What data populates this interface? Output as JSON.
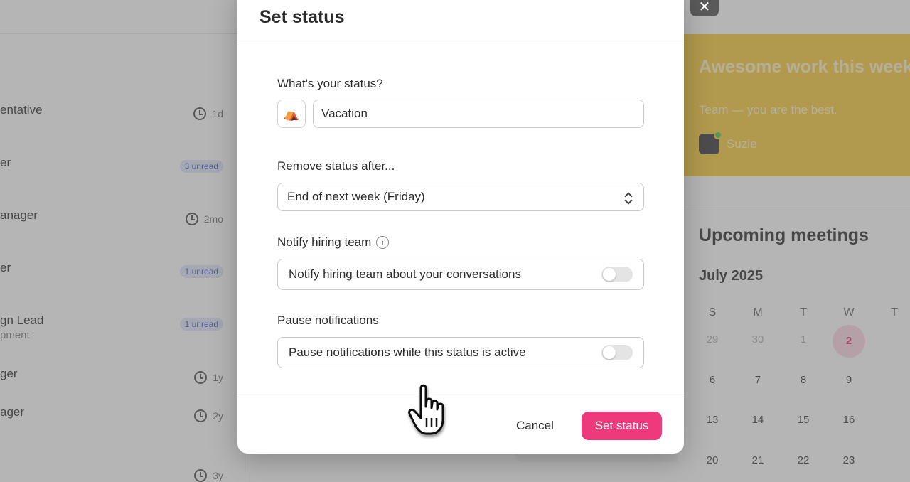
{
  "conversations": [
    {
      "title": "entative",
      "sub": "",
      "meta_type": "time",
      "meta": "1d"
    },
    {
      "title": "er",
      "sub": "",
      "meta_type": "badge",
      "meta": "3 unread"
    },
    {
      "title": "anager",
      "sub": "",
      "meta_type": "time",
      "meta": "2mo"
    },
    {
      "title": "er",
      "sub": "",
      "meta_type": "badge",
      "meta": "1 unread"
    },
    {
      "title": "gn Lead",
      "sub": "pment",
      "meta_type": "badge",
      "meta": "1 unread"
    },
    {
      "title": "ger",
      "sub": "",
      "meta_type": "time",
      "meta": "1y"
    },
    {
      "title": "ager",
      "sub": "",
      "meta_type": "time",
      "meta": "2y"
    },
    {
      "title": "",
      "sub": "",
      "meta_type": "time",
      "meta": "3y"
    }
  ],
  "kudos": {
    "title": "Awesome work this week",
    "text": "Team — you are the best.",
    "user": "Suzie"
  },
  "meetings": {
    "title": "Upcoming meetings",
    "month": "July 2025",
    "weekdays": [
      "S",
      "M",
      "T",
      "W",
      "T"
    ],
    "weeks": [
      [
        "29",
        "30",
        "1",
        "2",
        ""
      ],
      [
        "6",
        "7",
        "8",
        "9",
        ""
      ],
      [
        "13",
        "14",
        "15",
        "16",
        ""
      ],
      [
        "20",
        "21",
        "22",
        "23",
        ""
      ]
    ],
    "today": "2"
  },
  "modal": {
    "close_icon": "close-icon",
    "title": "Set status",
    "status_label": "What's your status?",
    "status_emoji": "⛺",
    "status_value": "Vacation",
    "remove_label": "Remove status after...",
    "remove_value": "End of next week (Friday)",
    "notify_label": "Notify hiring team",
    "notify_toggle_label": "Notify hiring team about your conversations",
    "notify_on": false,
    "pause_label": "Pause notifications",
    "pause_toggle_label": "Pause notifications while this status is active",
    "pause_on": false,
    "cancel_label": "Cancel",
    "submit_label": "Set status"
  },
  "colors": {
    "accent": "#ee3a7d",
    "kudos_bg": "#f7c92f",
    "today_bg": "#fbd7e3",
    "today_text": "#d8245b"
  }
}
